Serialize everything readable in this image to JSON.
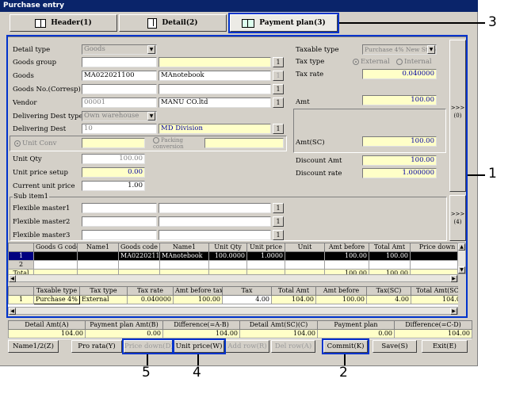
{
  "window": {
    "title": "Purchase entry"
  },
  "tabs": [
    {
      "label": "Header(1)",
      "icon": "book-icon"
    },
    {
      "label": "Detail(2)",
      "icon": "document-icon"
    },
    {
      "label": "Payment plan(3)",
      "icon": "monitor-icon"
    }
  ],
  "detail": {
    "detail_type_label": "Detail type",
    "detail_type_value": "Goods",
    "goods_group_label": "Goods group",
    "goods_label": "Goods",
    "goods_code": "MA022021100",
    "goods_name": "MAnotebook",
    "goods_no_label": "Goods No.(Corresp)",
    "vendor_label": "Vendor",
    "vendor_code": "00001",
    "vendor_name": "MANU CO.ltd",
    "dest_type_label": "Delivering Dest type",
    "dest_type_value": "Own warehouse",
    "dest_label": "Delivering Dest",
    "dest_code": "10",
    "dest_name": "MD Division",
    "unit_conv_label": "Unit Conv",
    "packing_label": "Packing conversion",
    "unit_qty_label": "Unit Qty",
    "unit_qty_value": "100.00",
    "unit_price_setup_label": "Unit price setup",
    "unit_price_setup_value": "0.00",
    "current_unit_price_label": "Current unit price",
    "current_unit_price_value": "1.00"
  },
  "tax": {
    "taxable_type_label": "Taxable type",
    "taxable_type_value": "Purchase 4% New Stand",
    "tax_type_label": "Tax type",
    "external_label": "External",
    "internal_label": "Internal",
    "tax_rate_label": "Tax rate",
    "tax_rate_value": "0.040000",
    "amt_label": "Amt",
    "amt_value": "100.00",
    "amt_sc_label": "Amt(SC)",
    "amt_sc_value": "100.00",
    "discount_amt_label": "Discount Amt",
    "discount_amt_value": "100.00",
    "discount_rate_label": "Discount rate",
    "discount_rate_value": "1.000000"
  },
  "side_buttons": [
    {
      "arrows": ">>>",
      "label": "(0)"
    },
    {
      "arrows": ">>>",
      "label": "(4)"
    }
  ],
  "sub_item": {
    "title": "Sub item1",
    "masters": [
      "Flexible master1",
      "Flexible master2",
      "Flexible master3"
    ]
  },
  "detail_grid": {
    "headers": [
      "",
      "Goods G code",
      "Name1",
      "Goods code",
      "Name1",
      "Unit Qty",
      "Unit price",
      "Unit",
      "Amt before",
      "Total Amt",
      "Price down"
    ],
    "rows": [
      [
        "1",
        "",
        "",
        "MA022021100",
        "MAnotebook",
        "100.0000",
        "1.0000",
        "",
        "100.00",
        "100.00",
        ""
      ],
      [
        "2",
        "",
        "",
        "",
        "",
        "",
        "",
        "",
        "",
        "",
        ""
      ],
      [
        "Total",
        "",
        "",
        "",
        "",
        "",
        "",
        "",
        "100.00",
        "100.00",
        ""
      ]
    ]
  },
  "tax_grid": {
    "headers": [
      "",
      "Taxable type",
      "Tax type",
      "Tax rate",
      "Amt before tax",
      "Tax",
      "Total Amt",
      "Amt before",
      "Tax(SC)",
      "Total Amt(SC)"
    ],
    "rows": [
      [
        "1",
        "Purchase 4% Nev",
        "External",
        "0.040000",
        "100.00",
        "4.00",
        "104.00",
        "100.00",
        "4.00",
        "104.00"
      ]
    ]
  },
  "summary": {
    "headers": [
      "Detail Amt(A)",
      "Payment plan Amt(B)",
      "Difference(=A-B)",
      "Detail Amt(SC)(C)",
      "Payment plan",
      "Difference(=C-D)"
    ],
    "values": [
      "104.00",
      "0.00",
      "104.00",
      "104.00",
      "0.00",
      "104.00"
    ]
  },
  "buttons": {
    "name": "Name1/2(Z)",
    "pro_rata": "Pro rata(Y)",
    "price_down": "Price down(D)",
    "unit_price": "Unit price(W)",
    "add_row": "Add row(R)",
    "del_row": "Del row(A)",
    "commit": "Commit(K)",
    "save": "Save(S)",
    "exit": "Exit(E)"
  },
  "callouts": [
    "1",
    "2",
    "3",
    "4",
    "5"
  ]
}
